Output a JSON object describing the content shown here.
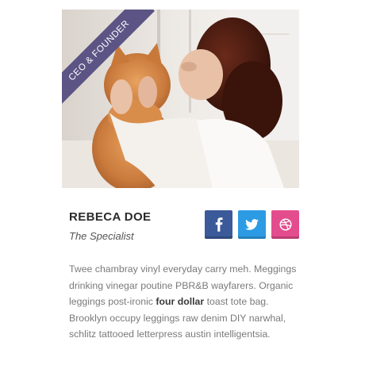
{
  "profile": {
    "ribbon_label": "CEO & FOUNDER",
    "name": "REBECA DOE",
    "role": "The Specialist",
    "bio_part1": "Twee chambray vinyl everyday carry meh. Meggings drinking vinegar poutine PBR&B wayfarers. Organic leggings post-ironic ",
    "bio_bold": "four dollar",
    "bio_part2": " toast tote bag. Brooklyn occupy leggings raw denim DIY narwhal, schlitz tattooed letterpress austin intelligentsia.",
    "photo": "woman-kissing-cat-photo"
  },
  "socials": [
    {
      "name": "facebook",
      "icon": "facebook-icon",
      "color": "#3b5a99"
    },
    {
      "name": "twitter",
      "icon": "twitter-icon",
      "color": "#2c9be3"
    },
    {
      "name": "dribbble",
      "icon": "dribbble-icon",
      "color": "#e34c8d"
    }
  ],
  "colors": {
    "ribbon": "#5b5484",
    "name": "#2b2b2b",
    "bio": "#7a7a7a"
  }
}
